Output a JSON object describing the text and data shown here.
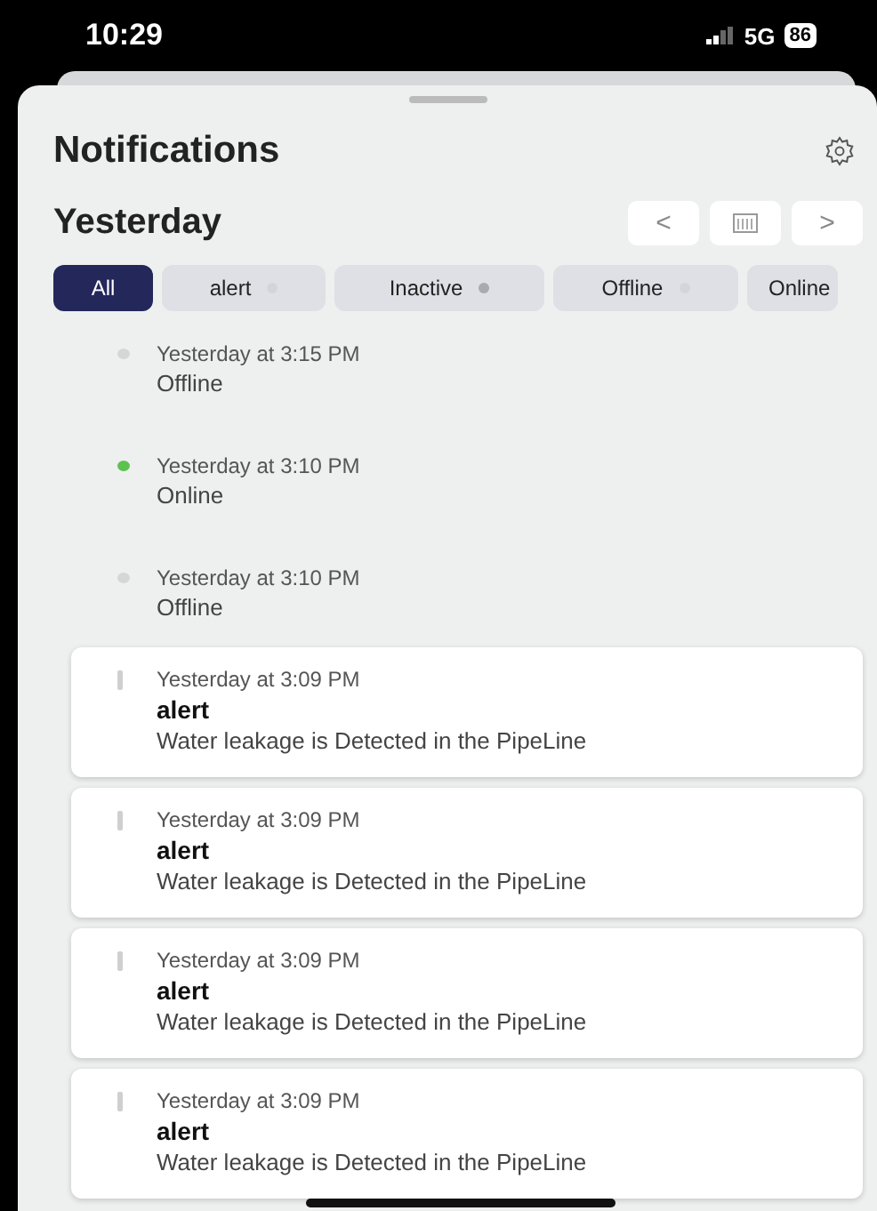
{
  "status_bar": {
    "time": "10:29",
    "network": "5G",
    "battery": "86"
  },
  "title": "Notifications",
  "day": {
    "label": "Yesterday",
    "prev": "<",
    "next": ">"
  },
  "filters": [
    {
      "label": "All",
      "selected": true
    },
    {
      "label": "alert",
      "selected": false,
      "color": "#d4d5da"
    },
    {
      "label": "Inactive",
      "selected": false,
      "color": "#a9aab0"
    },
    {
      "label": "Offline",
      "selected": false,
      "color": "#d4d5da"
    },
    {
      "label": "Online",
      "selected": false
    }
  ],
  "events": [
    {
      "kind": "status",
      "time": "Yesterday at 3:15 PM",
      "text": "Offline",
      "color": "#d6d6d6"
    },
    {
      "kind": "status",
      "time": "Yesterday at 3:10 PM",
      "text": "Online",
      "color": "#5cc24f"
    },
    {
      "kind": "status",
      "time": "Yesterday at 3:10 PM",
      "text": "Offline",
      "color": "#d6d6d6"
    },
    {
      "kind": "card",
      "time": "Yesterday at 3:09 PM",
      "title": "alert",
      "text": "Water leakage is Detected in the PipeLine",
      "color": "#cfcfcf"
    },
    {
      "kind": "card",
      "time": "Yesterday at 3:09 PM",
      "title": "alert",
      "text": "Water leakage is Detected in the PipeLine",
      "color": "#cfcfcf"
    },
    {
      "kind": "card",
      "time": "Yesterday at 3:09 PM",
      "title": "alert",
      "text": "Water leakage is Detected in the PipeLine",
      "color": "#cfcfcf"
    },
    {
      "kind": "card",
      "time": "Yesterday at 3:09 PM",
      "title": "alert",
      "text": "Water leakage is Detected in the PipeLine",
      "color": "#cfcfcf"
    }
  ]
}
